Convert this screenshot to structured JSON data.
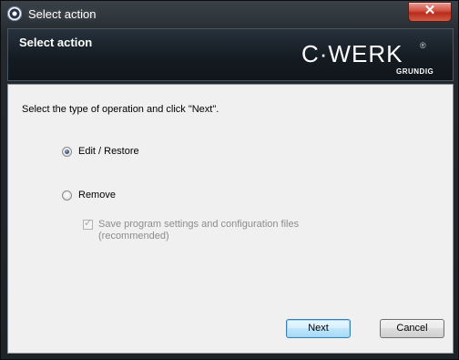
{
  "window": {
    "title": "Select action"
  },
  "titlebar": {
    "close_glyph": "✕",
    "icon": "cwerk-app-icon"
  },
  "header": {
    "title": "Select action",
    "logo": {
      "word": "C·WERK",
      "registered": "®",
      "sub": "GRUNDIG"
    }
  },
  "content": {
    "instruction": "Select the type of operation and click \"Next\".",
    "options": [
      {
        "label": "Edit / Restore",
        "checked": true
      },
      {
        "label": "Remove",
        "checked": false
      }
    ],
    "save_settings": {
      "line1": "Save program settings and configuration files",
      "line2": "(recommended)",
      "checked": true,
      "enabled": false
    }
  },
  "buttons": {
    "next": "Next",
    "cancel": "Cancel"
  },
  "colors": {
    "header_bg": "#141b22",
    "content_bg": "#f0f0f0",
    "close_red": "#c7402d",
    "default_button_border": "#3c7fb1"
  }
}
